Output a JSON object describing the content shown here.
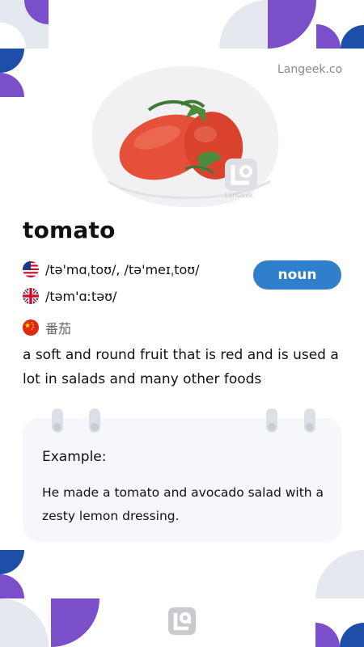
{
  "brand": {
    "site": "Langeek.co",
    "watermark": "LanGeek"
  },
  "entry": {
    "word": "tomato",
    "part_of_speech": "noun",
    "pronunciations": [
      {
        "flag": "us-flag-icon",
        "text": "/tə'mɑˌtoʊ/, /tə'meɪˌtoʊ/"
      },
      {
        "flag": "uk-flag-icon",
        "text": "/təm'ɑːtəʊ/"
      }
    ],
    "translation": {
      "flag": "china-flag-icon",
      "text": "番茄"
    },
    "definition": "a soft and round fruit that is red and is used a lot in salads and many other foods"
  },
  "example": {
    "label": "Example:",
    "text": "He made a tomato and avocado salad with a zesty lemon dressing."
  },
  "colors": {
    "accent_blue": "#2f7fcd",
    "purple": "#7b4fc9",
    "navy": "#1d4fa8",
    "card_bg": "#f5f7fb",
    "tomato": "#e4503a"
  }
}
